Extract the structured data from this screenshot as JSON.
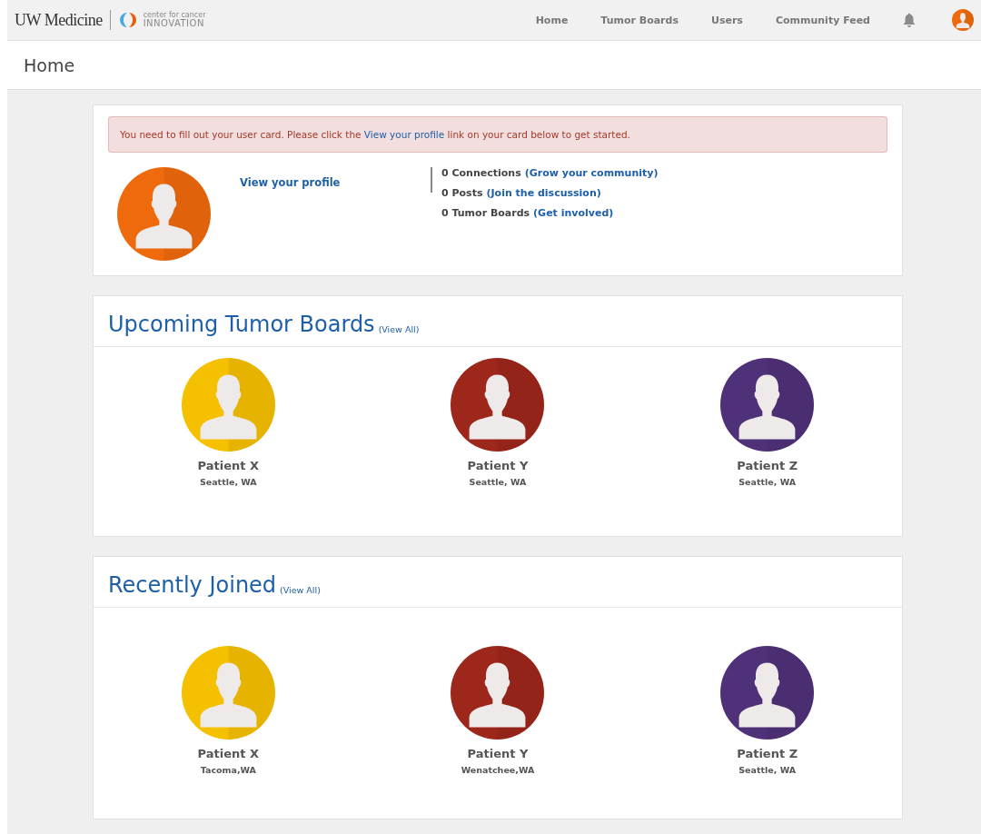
{
  "brand": {
    "name": "UW Medicine",
    "tagline_top": "center for cancer",
    "tagline_bottom": "INNOVATION"
  },
  "nav": [
    {
      "label": "Home"
    },
    {
      "label": "Tumor Boards"
    },
    {
      "label": "Users"
    },
    {
      "label": "Community Feed"
    }
  ],
  "page_title": "Home",
  "profile_card": {
    "alert": {
      "before": "You need to fill out your user card. Please click the ",
      "link": "View your profile",
      "after": " link on your card below to get started."
    },
    "profile_link": "View your profile",
    "stats": [
      {
        "text": "0 Connections",
        "link": "(Grow your community)"
      },
      {
        "text": "0 Posts",
        "link": "(Join the discussion)"
      },
      {
        "text": "0 Tumor Boards",
        "link": "(Get involved)"
      }
    ]
  },
  "sections": [
    {
      "title": "Upcoming Tumor Boards",
      "view_all": "(View All)",
      "people": [
        {
          "name": "Patient X",
          "location": "Seattle, WA",
          "color": "#f5c000"
        },
        {
          "name": "Patient Y",
          "location": "Seattle, WA",
          "color": "#9e271c"
        },
        {
          "name": "Patient Z",
          "location": "Seattle, WA",
          "color": "#4f3179"
        }
      ]
    },
    {
      "title": "Recently Joined",
      "view_all": "(View All)",
      "people": [
        {
          "name": "Patient X",
          "location": "Tacoma,WA",
          "color": "#f5c000"
        },
        {
          "name": "Patient Y",
          "location": "Wenatchee,WA",
          "color": "#9e271c"
        },
        {
          "name": "Patient Z",
          "location": "Seattle, WA",
          "color": "#4f3179"
        }
      ]
    }
  ]
}
